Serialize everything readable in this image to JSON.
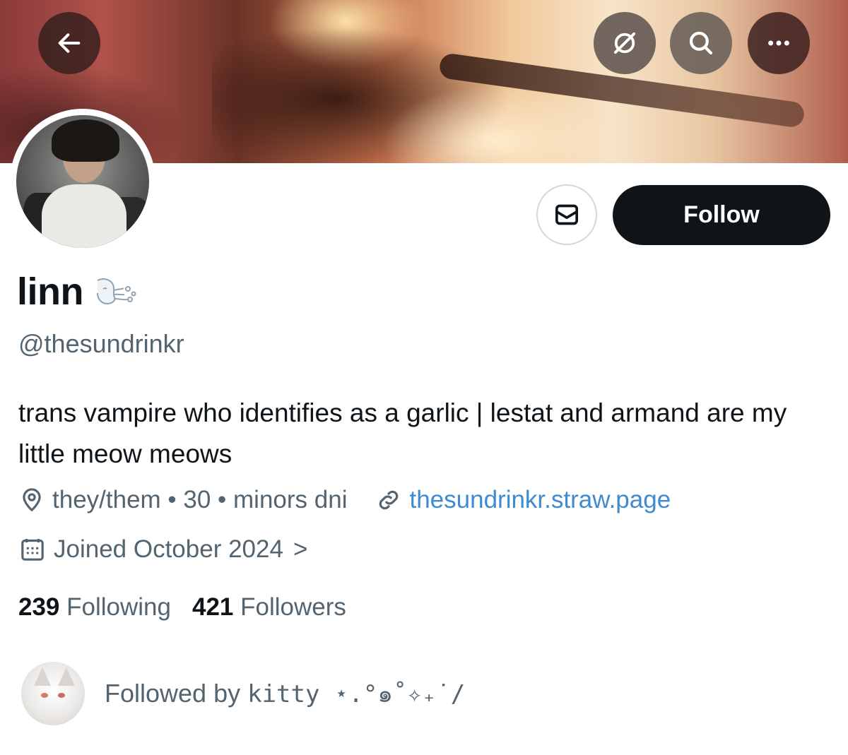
{
  "header": {
    "back_icon": "arrow-left-icon",
    "grok_icon": "slashed-circle-icon",
    "search_icon": "search-icon",
    "more_icon": "ellipsis-icon"
  },
  "actions": {
    "message_icon": "envelope-icon",
    "follow_label": "Follow"
  },
  "profile": {
    "display_name": "linn",
    "name_emoji": "wind-face-emoji",
    "handle": "@thesundrinkr",
    "bio": "trans vampire who identifies as a garlic | lestat and armand are my little meow meows",
    "location": "they/them • 30 • minors dni",
    "website": "thesundrinkr.straw.page",
    "joined": "Joined October 2024",
    "joined_chevron": ">"
  },
  "stats": {
    "following_count": "239",
    "following_label": "Following",
    "followers_count": "421",
    "followers_label": "Followers"
  },
  "followed_by": {
    "prefix": "Followed by",
    "name": "kitty ⋆.°๑˚✧₊˙/"
  },
  "colors": {
    "link": "#3d8bd0",
    "secondary_text": "#536471",
    "follow_button_bg": "#0f1419"
  }
}
